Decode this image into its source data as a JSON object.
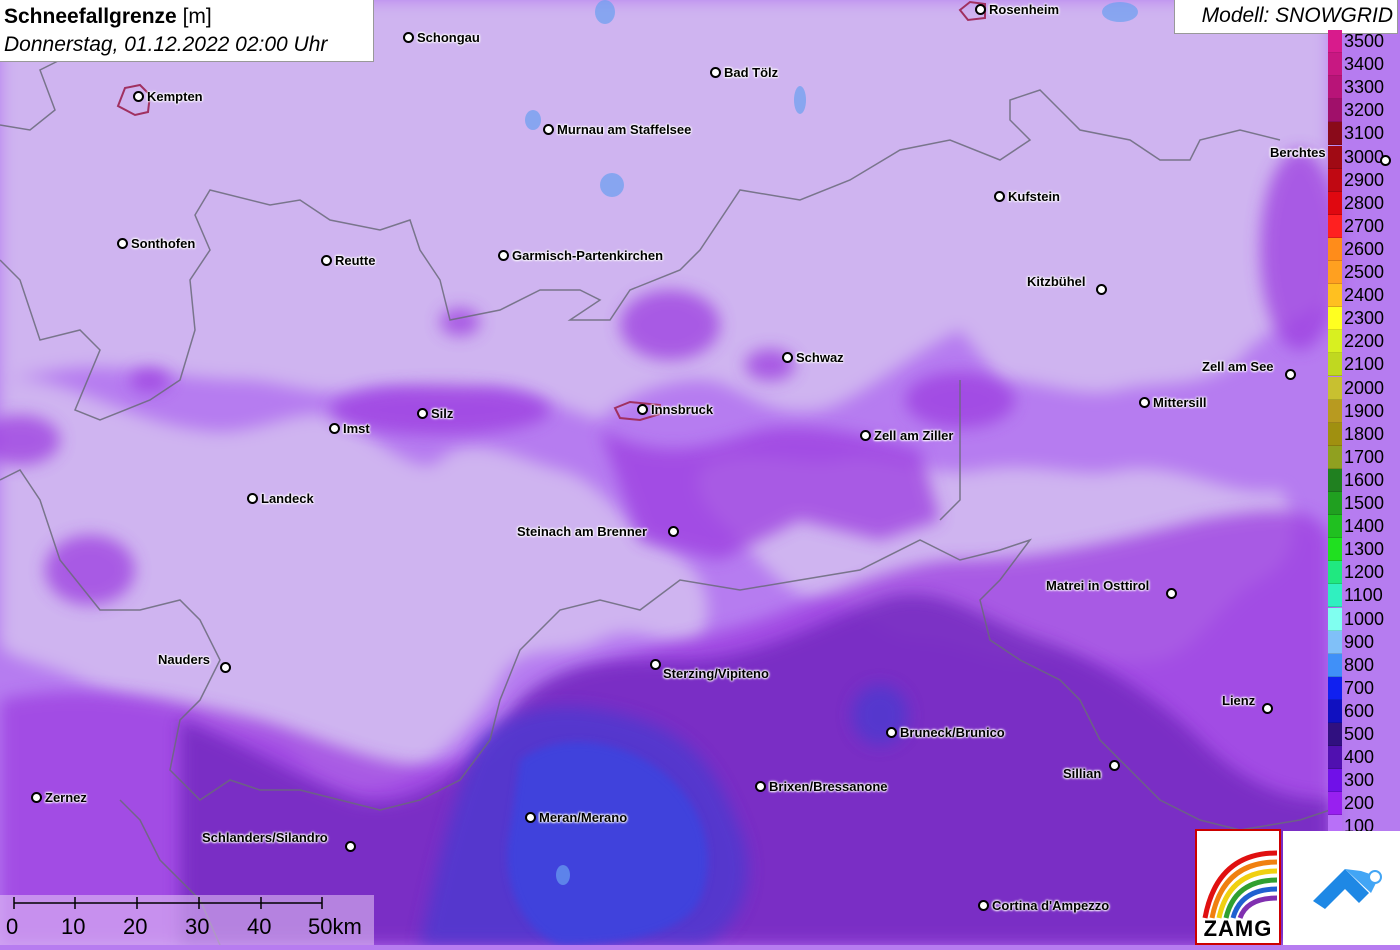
{
  "title": {
    "main": "Schneefallgrenze",
    "unit": "[m]",
    "datetime": "Donnerstag, 01.12.2022 02:00 Uhr"
  },
  "model": "Modell: SNOWGRID",
  "legend": [
    {
      "label": "3500",
      "color": "#d81b8c"
    },
    {
      "label": "3400",
      "color": "#c81882"
    },
    {
      "label": "3300",
      "color": "#b81478"
    },
    {
      "label": "3200",
      "color": "#a0106a"
    },
    {
      "label": "3100",
      "color": "#8a0a1a"
    },
    {
      "label": "3000",
      "color": "#a00a14"
    },
    {
      "label": "2900",
      "color": "#c00812"
    },
    {
      "label": "2800",
      "color": "#e00810"
    },
    {
      "label": "2700",
      "color": "#ff2020"
    },
    {
      "label": "2600",
      "color": "#ff8c1a"
    },
    {
      "label": "2500",
      "color": "#ffa020"
    },
    {
      "label": "2400",
      "color": "#ffc020"
    },
    {
      "label": "2300",
      "color": "#ffff20"
    },
    {
      "label": "2200",
      "color": "#d8f020"
    },
    {
      "label": "2100",
      "color": "#c0d820"
    },
    {
      "label": "2000",
      "color": "#c8c030"
    },
    {
      "label": "1900",
      "color": "#b89a20"
    },
    {
      "label": "1800",
      "color": "#a09010"
    },
    {
      "label": "1700",
      "color": "#90a020"
    },
    {
      "label": "1600",
      "color": "#208020"
    },
    {
      "label": "1500",
      "color": "#20a020"
    },
    {
      "label": "1400",
      "color": "#20c020"
    },
    {
      "label": "1300",
      "color": "#20e020"
    },
    {
      "label": "1200",
      "color": "#20e880"
    },
    {
      "label": "1100",
      "color": "#30f0c0"
    },
    {
      "label": "1000",
      "color": "#80fff0"
    },
    {
      "label": "900",
      "color": "#80c0f8"
    },
    {
      "label": "800",
      "color": "#4090f8"
    },
    {
      "label": "700",
      "color": "#1020f0"
    },
    {
      "label": "600",
      "color": "#1010c0"
    },
    {
      "label": "500",
      "color": "#301080"
    },
    {
      "label": "400",
      "color": "#5010b0"
    },
    {
      "label": "300",
      "color": "#7010e8"
    },
    {
      "label": "200",
      "color": "#9820f0"
    },
    {
      "label": "100",
      "color": "#b870f8"
    }
  ],
  "cities": [
    {
      "name": "Rosenheim",
      "side": "right"
    },
    {
      "name": "Schongau",
      "side": "right"
    },
    {
      "name": "Kempten",
      "side": "right"
    },
    {
      "name": "Bad Tölz",
      "side": "right"
    },
    {
      "name": "Murnau am Staffelsee",
      "side": "right"
    },
    {
      "name": "Berchtes",
      "side": "left"
    },
    {
      "name": "Kufstein",
      "side": "right"
    },
    {
      "name": "Sonthofen",
      "side": "right"
    },
    {
      "name": "Reutte",
      "side": "right"
    },
    {
      "name": "Garmisch-Partenkirchen",
      "side": "right"
    },
    {
      "name": "Kitzbühel",
      "side": "left"
    },
    {
      "name": "Schwaz",
      "side": "right"
    },
    {
      "name": "Zell am See",
      "side": "left"
    },
    {
      "name": "Mittersill",
      "side": "right"
    },
    {
      "name": "Imst",
      "side": "right"
    },
    {
      "name": "Silz",
      "side": "right"
    },
    {
      "name": "Innsbruck",
      "side": "right"
    },
    {
      "name": "Zell am Ziller",
      "side": "right"
    },
    {
      "name": "Landeck",
      "side": "right"
    },
    {
      "name": "Steinach am Brenner",
      "side": "left"
    },
    {
      "name": "Matrei in Osttirol",
      "side": "left"
    },
    {
      "name": "Nauders",
      "side": "left"
    },
    {
      "name": "Sterzing/Vipiteno",
      "side": "right"
    },
    {
      "name": "Lienz",
      "side": "left"
    },
    {
      "name": "Bruneck/Brunico",
      "side": "right"
    },
    {
      "name": "Sillian",
      "side": "left"
    },
    {
      "name": "Brixen/Bressanone",
      "side": "right"
    },
    {
      "name": "Zernez",
      "side": "right"
    },
    {
      "name": "Meran/Merano",
      "side": "right"
    },
    {
      "name": "Schlanders/Silandro",
      "side": "left"
    },
    {
      "name": "Cortina d'Ampezzo",
      "side": "right"
    }
  ],
  "scale": {
    "labels": [
      "0",
      "10",
      "20",
      "30",
      "40",
      "50km"
    ]
  },
  "logos": {
    "zamg_text": "ZAMG"
  }
}
